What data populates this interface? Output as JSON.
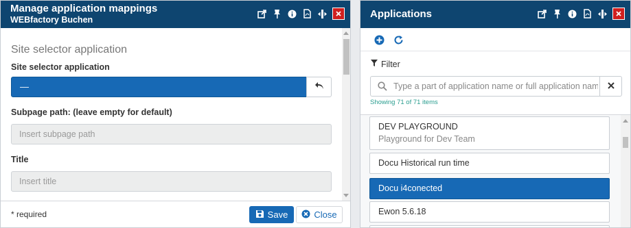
{
  "left_panel": {
    "title": "Manage application mappings",
    "subtitle": "WEBfactory Buchen",
    "section_heading": "Site selector application",
    "site_selector_label": "Site selector application",
    "site_selector_value": "—",
    "subpage_label": "Subpage path: (leave empty for default)",
    "subpage_placeholder": "Insert subpage path",
    "title_label": "Title",
    "title_placeholder": "Insert title",
    "required_note": "* required",
    "save_label": "Save",
    "close_label": "Close"
  },
  "right_panel": {
    "title": "Applications",
    "filter_label": "Filter",
    "search_placeholder": "Type a part of application name or full application name",
    "count_text": "Showing 71 of 71 items",
    "items": [
      {
        "name": "DEV PLAYGROUND",
        "description": "Playground for Dev Team"
      },
      {
        "name": "Docu Historical run time"
      },
      {
        "name": "Docu i4conected",
        "selected": true
      },
      {
        "name": "Ewon 5.6.18"
      }
    ]
  },
  "header_icons": [
    "popout-icon",
    "pin-icon",
    "info-icon",
    "pdf-icon",
    "resize-icon",
    "close-icon"
  ],
  "colors": {
    "header": "#0e4570",
    "accent": "#1769b5",
    "close_red": "#d01f1f",
    "count_text": "#2a9d8f"
  }
}
